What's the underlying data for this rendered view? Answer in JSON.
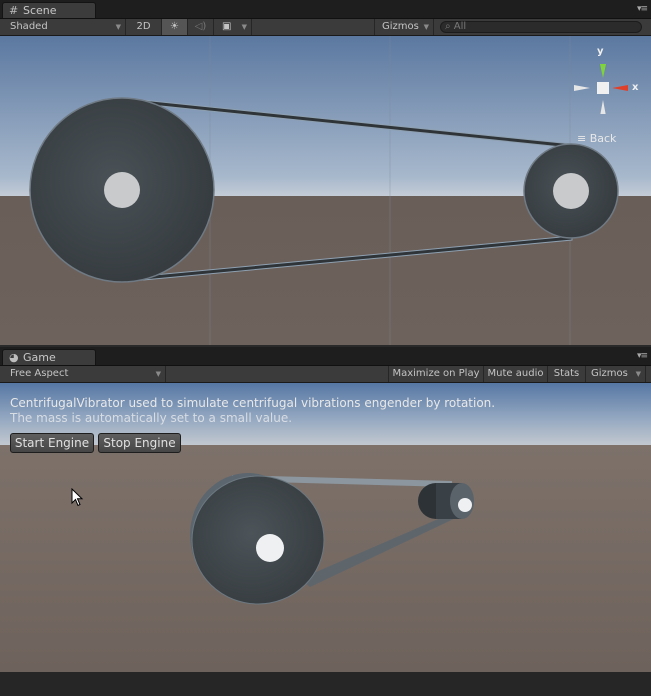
{
  "scene": {
    "tab_label": "Scene",
    "shading_mode": "Shaded",
    "mode_2d": "2D",
    "gizmos_label": "Gizmos",
    "search_placeholder": "All",
    "orientation": {
      "y_label": "y",
      "x_label": "x",
      "view_label": "Back"
    }
  },
  "game": {
    "tab_label": "Game",
    "aspect": "Free Aspect",
    "maximize_on_play": "Maximize on Play",
    "mute_audio": "Mute audio",
    "stats": "Stats",
    "gizmos_label": "Gizmos",
    "description_line1": "CentrifugalVibrator used to simulate centrifugal vibrations engender by rotation.",
    "description_line2": "The mass is automatically set to a small value.",
    "start_engine": "Start Engine",
    "stop_engine": "Stop Engine"
  },
  "colors": {
    "sky_top": "#5b78a0",
    "ground": "#6e625c",
    "wheel": "#3d4448",
    "x_axis": "#e0402a",
    "y_axis": "#7fd43a"
  }
}
